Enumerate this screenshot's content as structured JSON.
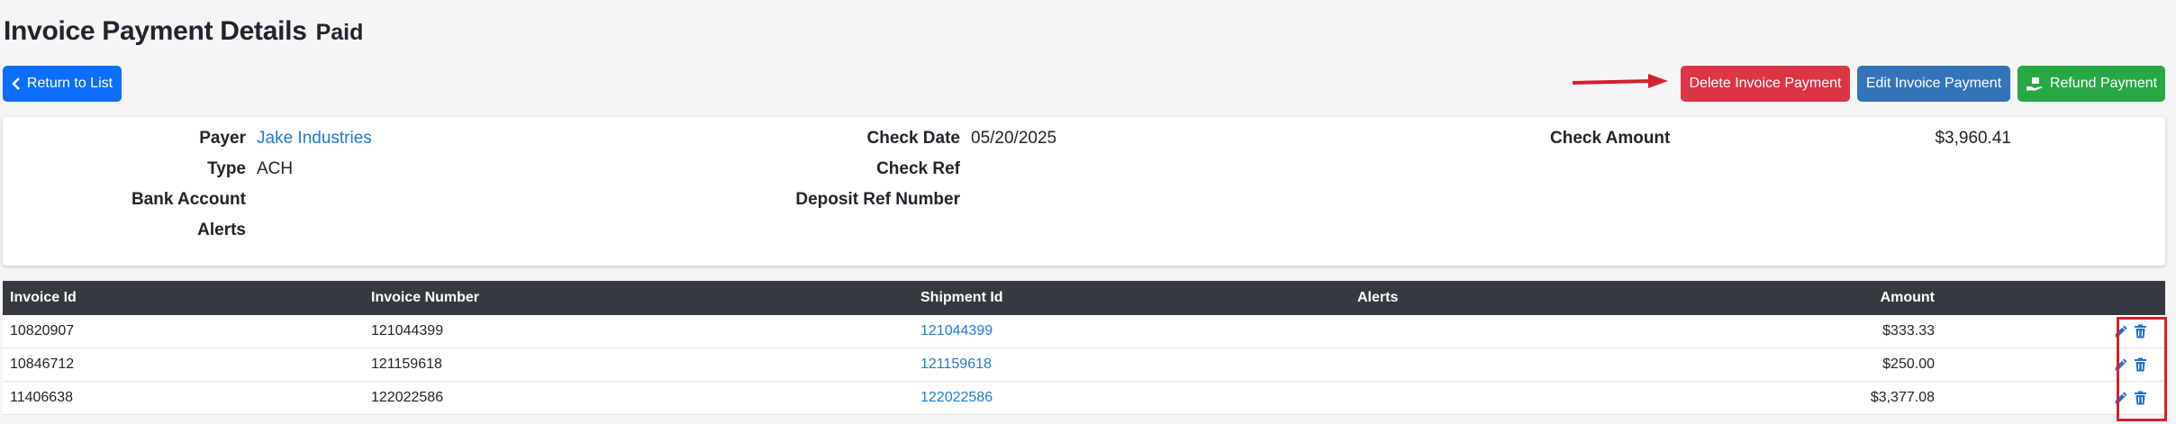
{
  "page": {
    "title": "Invoice Payment Details",
    "status": "Paid"
  },
  "buttons": {
    "return_label": "Return to List",
    "delete_label": "Delete Invoice Payment",
    "edit_label": "Edit Invoice Payment",
    "refund_label": "Refund Payment"
  },
  "details": {
    "payer_label": "Payer",
    "payer_value": "Jake Industries",
    "type_label": "Type",
    "type_value": "ACH",
    "bank_label": "Bank Account",
    "alerts_label": "Alerts",
    "check_date_label": "Check Date",
    "check_date_value": "05/20/2025",
    "check_ref_label": "Check Ref",
    "deposit_ref_label": "Deposit Ref Number",
    "check_amount_label": "Check Amount",
    "check_amount_value": "$3,960.41"
  },
  "table": {
    "headers": [
      "Invoice Id",
      "Invoice Number",
      "Shipment Id",
      "Alerts",
      "Amount"
    ],
    "rows": [
      {
        "invoice_id": "10820907",
        "invoice_number": "121044399",
        "shipment_id": "121044399",
        "alerts": "",
        "amount": "$333.33"
      },
      {
        "invoice_id": "10846712",
        "invoice_number": "121159618",
        "shipment_id": "121159618",
        "alerts": "",
        "amount": "$250.00"
      },
      {
        "invoice_id": "11406638",
        "invoice_number": "122022586",
        "shipment_id": "122022586",
        "alerts": "",
        "amount": "$3,377.08"
      }
    ]
  },
  "colors": {
    "primary": "#0d6efd",
    "danger": "#dc3545",
    "edit": "#3374b8",
    "success": "#28a745",
    "link": "#1c7ed6",
    "header_bg": "#343a40",
    "annotation": "#d6202f"
  },
  "icons": {
    "return": "chevron-left-icon",
    "refund": "hand-money-icon",
    "row_edit": "pencil-icon",
    "row_delete": "trash-icon"
  }
}
